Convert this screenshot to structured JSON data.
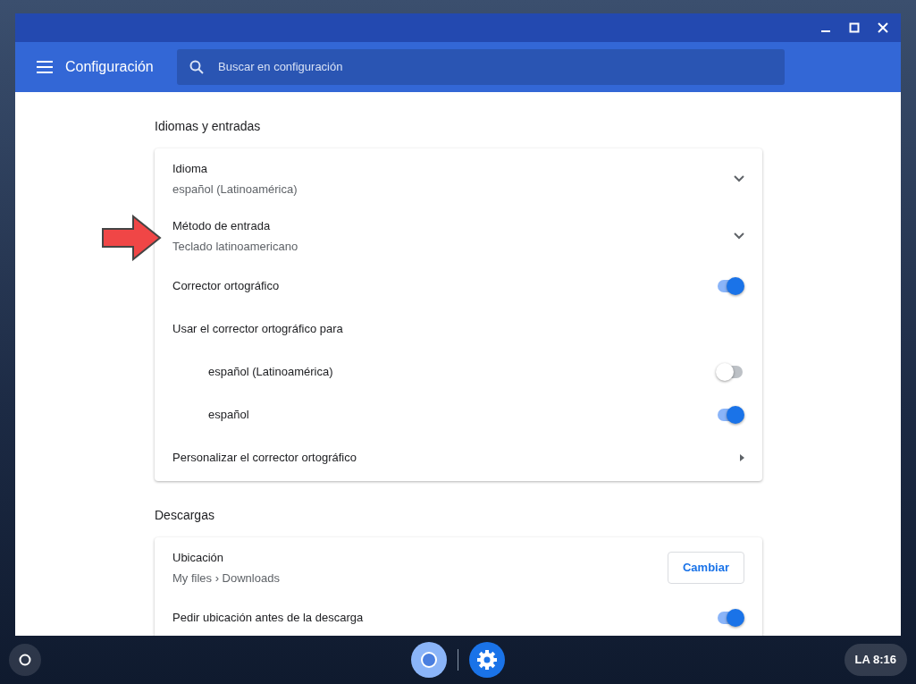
{
  "window": {
    "title": "Configuración",
    "search": {
      "placeholder": "Buscar en configuración"
    }
  },
  "sections": [
    {
      "title": "Idiomas y entradas",
      "rows": [
        {
          "kind": "expand",
          "label": "Idioma",
          "value": "español (Latinoamérica)",
          "expanded": false
        },
        {
          "kind": "expand",
          "label": "Método de entrada",
          "value": "Teclado latinoamericano",
          "expanded": false
        },
        {
          "kind": "toggle",
          "label": "Corrector ortográfico",
          "on": true
        },
        {
          "kind": "label",
          "label": "Usar el corrector ortográfico para"
        },
        {
          "kind": "subtoggle",
          "label": "español (Latinoamérica)",
          "on": false
        },
        {
          "kind": "subtoggle",
          "label": "español",
          "on": true
        },
        {
          "kind": "link",
          "label": "Personalizar el corrector ortográfico"
        }
      ]
    },
    {
      "title": "Descargas",
      "rows": [
        {
          "kind": "button",
          "label": "Ubicación",
          "value": "My files › Downloads",
          "button": "Cambiar"
        },
        {
          "kind": "toggle",
          "label": "Pedir ubicación antes de la descarga",
          "on": true
        }
      ]
    }
  ],
  "taskbar": {
    "status": "LA 8:16"
  }
}
